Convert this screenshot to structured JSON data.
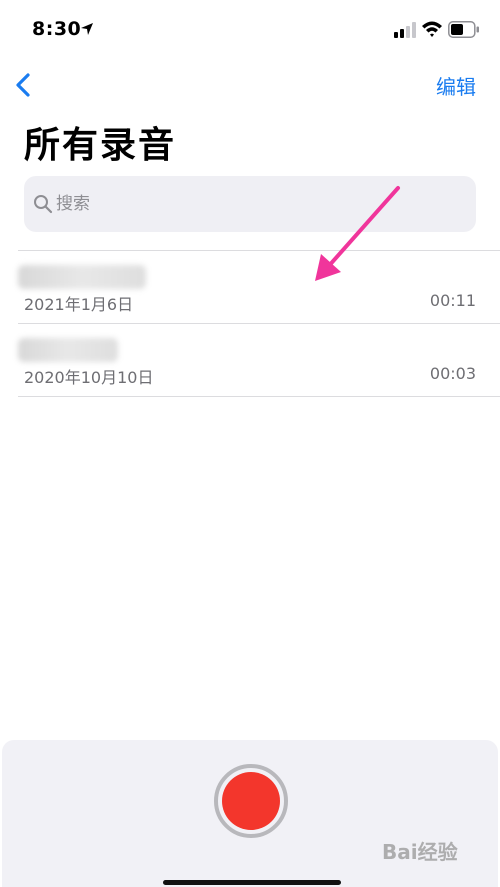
{
  "status_bar": {
    "time": "8:30",
    "icons": [
      "location-arrow-icon",
      "cellular-signal-icon",
      "wifi-icon",
      "battery-icon"
    ]
  },
  "nav": {
    "back_icon": "chevron-left-icon",
    "edit_label": "编辑"
  },
  "page": {
    "title": "所有录音"
  },
  "search": {
    "placeholder": "搜索",
    "icon": "search-icon"
  },
  "recordings": [
    {
      "name": "",
      "date": "2021年1月6日",
      "duration": "00:11"
    },
    {
      "name": "",
      "date": "2020年10月10日",
      "duration": "00:03"
    }
  ],
  "bottom": {
    "record_icon": "record-icon"
  },
  "watermark": {
    "text": "Bai经验"
  },
  "colors": {
    "accent": "#1a7cf0",
    "record": "#f3362c",
    "annotation_arrow": "#f0359b"
  }
}
